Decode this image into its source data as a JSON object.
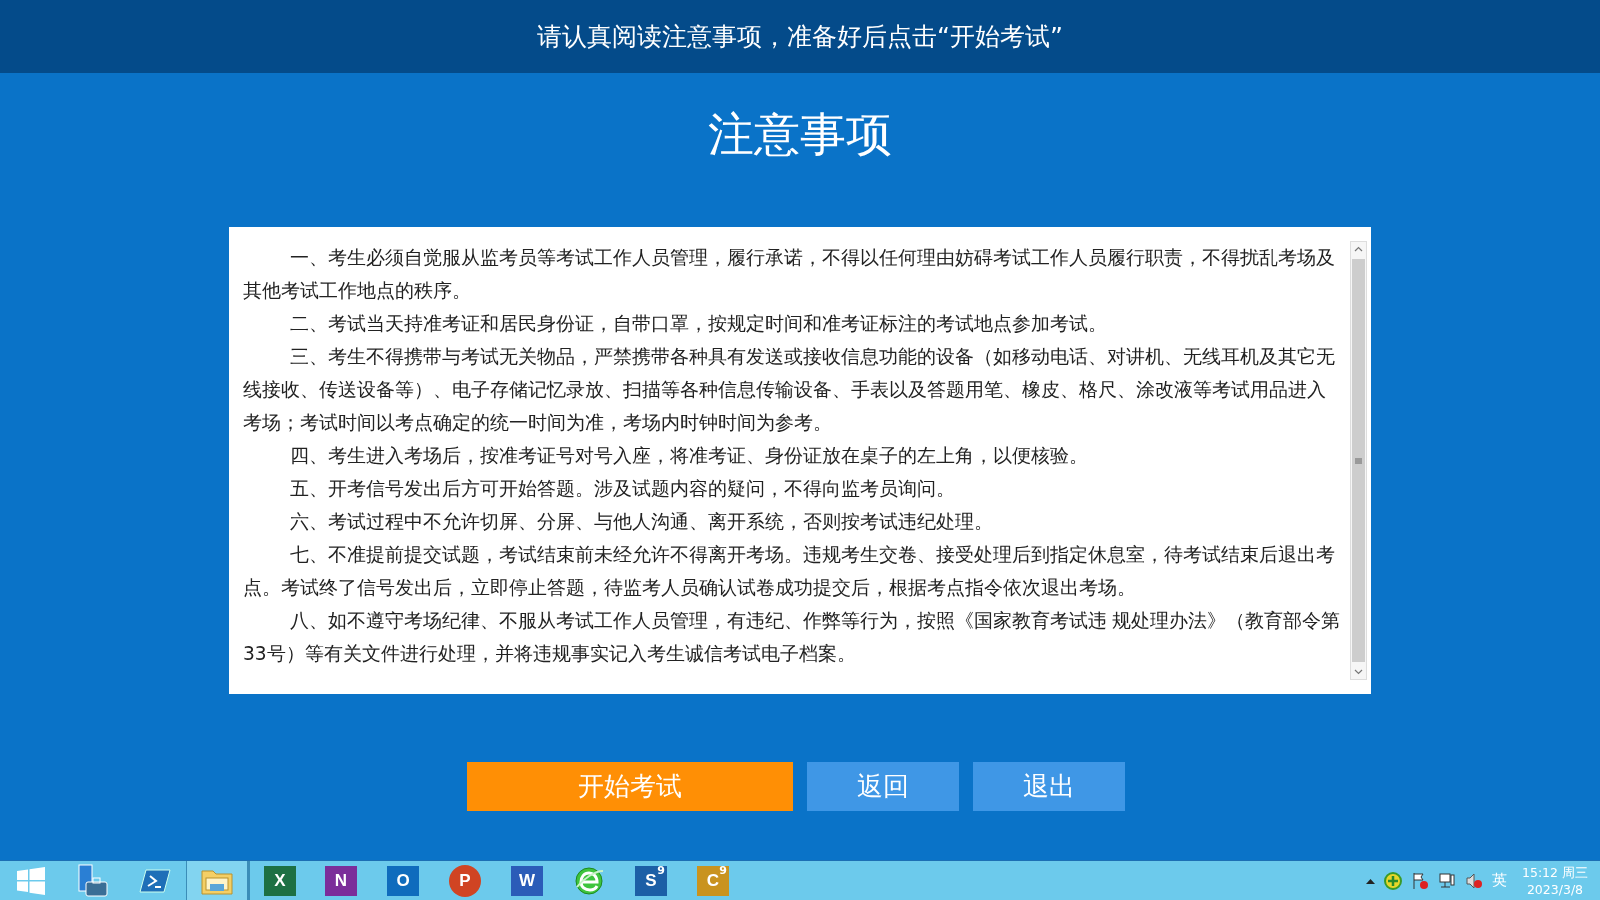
{
  "header": {
    "title": "请认真阅读注意事项，准备好后点击“开始考试”"
  },
  "page_title": "注意事项",
  "notice": {
    "paragraphs": [
      "一、考生必须自觉服从监考员等考试工作人员管理，履行承诺，不得以任何理由妨碍考试工作人员履行职责，不得扰乱考场及其他考试工作地点的秩序。",
      "二、考试当天持准考证和居民身份证，自带口罩，按规定时间和准考证标注的考试地点参加考试。",
      "三、考生不得携带与考试无关物品，严禁携带各种具有发送或接收信息功能的设备（如移动电话、对讲机、无线耳机及其它无线接收、传送设备等）、电子存储记忆录放、扫描等各种信息传输设备、手表以及答题用笔、橡皮、格尺、涂改液等考试用品进入考场；考试时间以考点确定的统一时间为准，考场内时钟时间为参考。",
      "四、考生进入考场后，按准考证号对号入座，将准考证、身份证放在桌子的左上角，以便核验。",
      "五、开考信号发出后方可开始答题。涉及试题内容的疑问，不得向监考员询问。",
      "六、考试过程中不允许切屏、分屏、与他人沟通、离开系统，否则按考试违纪处理。",
      "七、不准提前提交试题，考试结束前未经允许不得离开考场。违规考生交卷、接受处理后到指定休息室，待考试结束后退出考点。考试终了信号发出后，立即停止答题，待监考人员确认试卷成功提交后，根据考点指令依次退出考场。",
      "八、如不遵守考场纪律、不服从考试工作人员管理，有违纪、作弊等行为，按照《国家教育考试违 规处理办法》（教育部令第33号）等有关文件进行处理，并将违规事实记入考生诚信考试电子档案。"
    ]
  },
  "buttons": [
    {
      "label": "开始考试",
      "kind": "primary"
    },
    {
      "label": "返回",
      "kind": "secondary"
    },
    {
      "label": "退出",
      "kind": "secondary"
    }
  ],
  "taskbar": {
    "apps": [
      {
        "kind": "start"
      },
      {
        "kind": "server"
      },
      {
        "kind": "shell"
      },
      {
        "kind": "folder"
      },
      {
        "kind": "tile",
        "letter": "X",
        "color": "#1d7044"
      },
      {
        "kind": "tile",
        "letter": "N",
        "color": "#7b2d9a"
      },
      {
        "kind": "tile",
        "letter": "O",
        "color": "#0f6cbd"
      },
      {
        "kind": "round",
        "letter": "P",
        "color": "#d04423"
      },
      {
        "kind": "tile",
        "letter": "W",
        "color": "#2b5cb8"
      },
      {
        "kind": "browser"
      },
      {
        "kind": "tile",
        "letter": "S",
        "sup": "9",
        "color": "#1c5fa6"
      },
      {
        "kind": "tile",
        "letter": "C",
        "sup": "9",
        "color": "#c9931f"
      }
    ],
    "tray": {
      "ime": "英",
      "time": "15:12 周三",
      "date": "2023/3/8"
    }
  }
}
